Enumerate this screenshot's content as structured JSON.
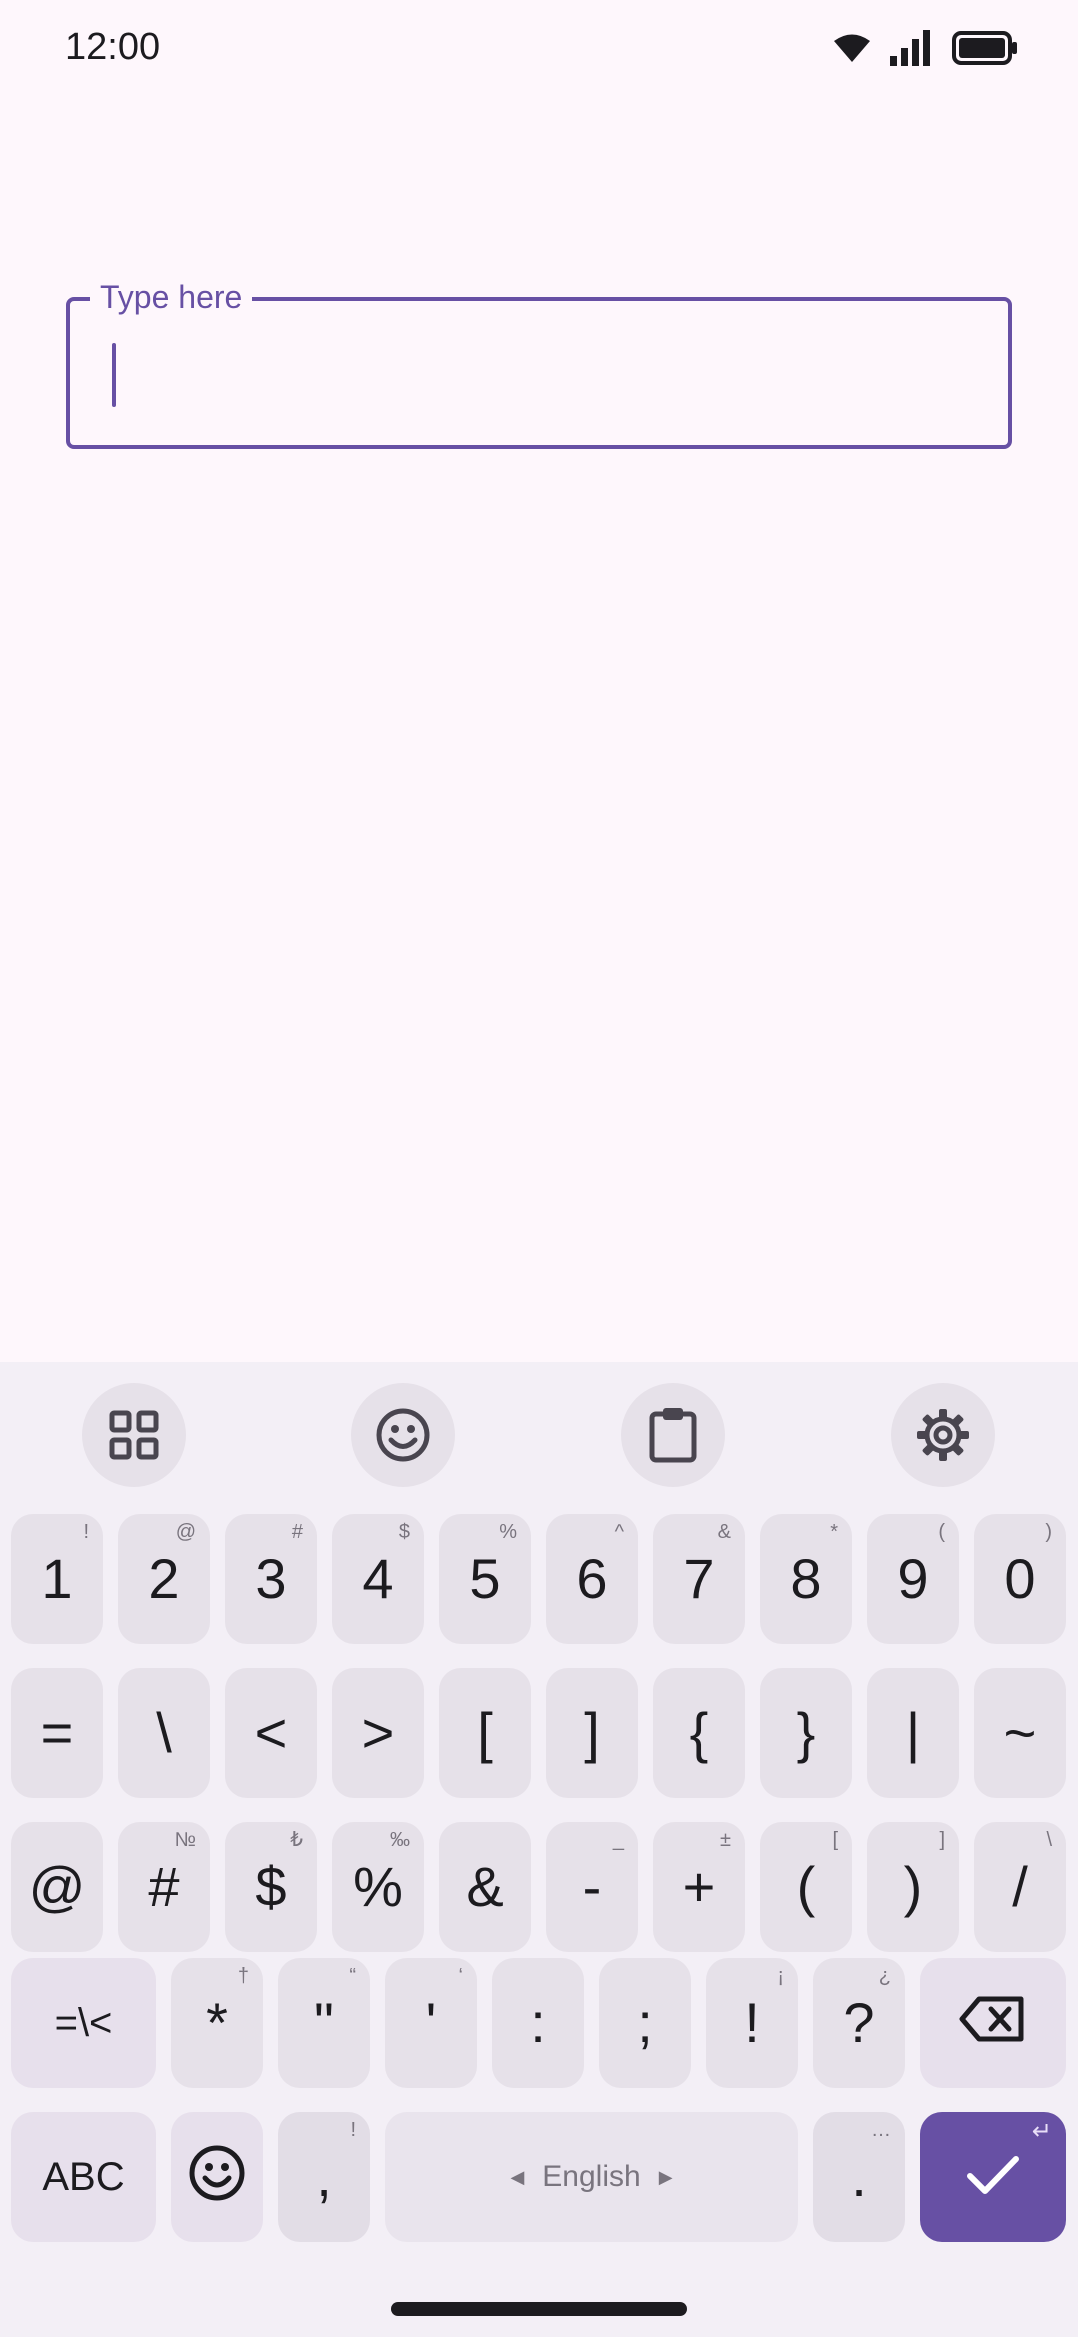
{
  "status_bar": {
    "time": "12:00",
    "icons": [
      "wifi-icon",
      "signal-icon",
      "battery-icon"
    ]
  },
  "text_field": {
    "label": "Type here",
    "value": ""
  },
  "keyboard": {
    "toolbar": [
      "grid-icon",
      "emoji-icon",
      "clipboard-icon",
      "settings-icon"
    ],
    "row1": [
      {
        "main": "1",
        "hint": "!"
      },
      {
        "main": "2",
        "hint": "@"
      },
      {
        "main": "3",
        "hint": "#"
      },
      {
        "main": "4",
        "hint": "$"
      },
      {
        "main": "5",
        "hint": "%"
      },
      {
        "main": "6",
        "hint": "^"
      },
      {
        "main": "7",
        "hint": "&"
      },
      {
        "main": "8",
        "hint": "*"
      },
      {
        "main": "9",
        "hint": "("
      },
      {
        "main": "0",
        "hint": ")"
      }
    ],
    "row2": [
      {
        "main": "=",
        "hint": ""
      },
      {
        "main": "\\",
        "hint": ""
      },
      {
        "main": "<",
        "hint": ""
      },
      {
        "main": ">",
        "hint": ""
      },
      {
        "main": "[",
        "hint": ""
      },
      {
        "main": "]",
        "hint": ""
      },
      {
        "main": "{",
        "hint": ""
      },
      {
        "main": "}",
        "hint": ""
      },
      {
        "main": "|",
        "hint": ""
      },
      {
        "main": "~",
        "hint": ""
      }
    ],
    "row3": [
      {
        "main": "@",
        "hint": ""
      },
      {
        "main": "#",
        "hint": "№"
      },
      {
        "main": "$",
        "hint": "₺"
      },
      {
        "main": "%",
        "hint": "‰"
      },
      {
        "main": "&",
        "hint": ""
      },
      {
        "main": "-",
        "hint": "_"
      },
      {
        "main": "+",
        "hint": "±"
      },
      {
        "main": "(",
        "hint": "["
      },
      {
        "main": ")",
        "hint": "]"
      },
      {
        "main": "/",
        "hint": "\\"
      }
    ],
    "row4": {
      "shift_label": "=\\<",
      "keys": [
        {
          "main": "*",
          "hint": "†"
        },
        {
          "main": "\"",
          "hint": "“"
        },
        {
          "main": "'",
          "hint": "‘"
        },
        {
          "main": ":",
          "hint": ""
        },
        {
          "main": ";",
          "hint": ""
        },
        {
          "main": "!",
          "hint": "¡"
        },
        {
          "main": "?",
          "hint": "¿"
        }
      ],
      "backspace_icon": "backspace-icon"
    },
    "row5": {
      "abc_label": "ABC",
      "emoji_icon": "emoji-icon",
      "comma": {
        "main": ",",
        "hint": "!"
      },
      "space_label": "English",
      "period": {
        "main": ".",
        "hint": "…"
      },
      "enter_hint": "↵",
      "enter_icon": "check-icon"
    }
  },
  "colors": {
    "accent": "#6750a4",
    "background": "#fef7fc",
    "keyboard_bg": "#f3eff6",
    "key_bg": "#e6e1e9"
  }
}
